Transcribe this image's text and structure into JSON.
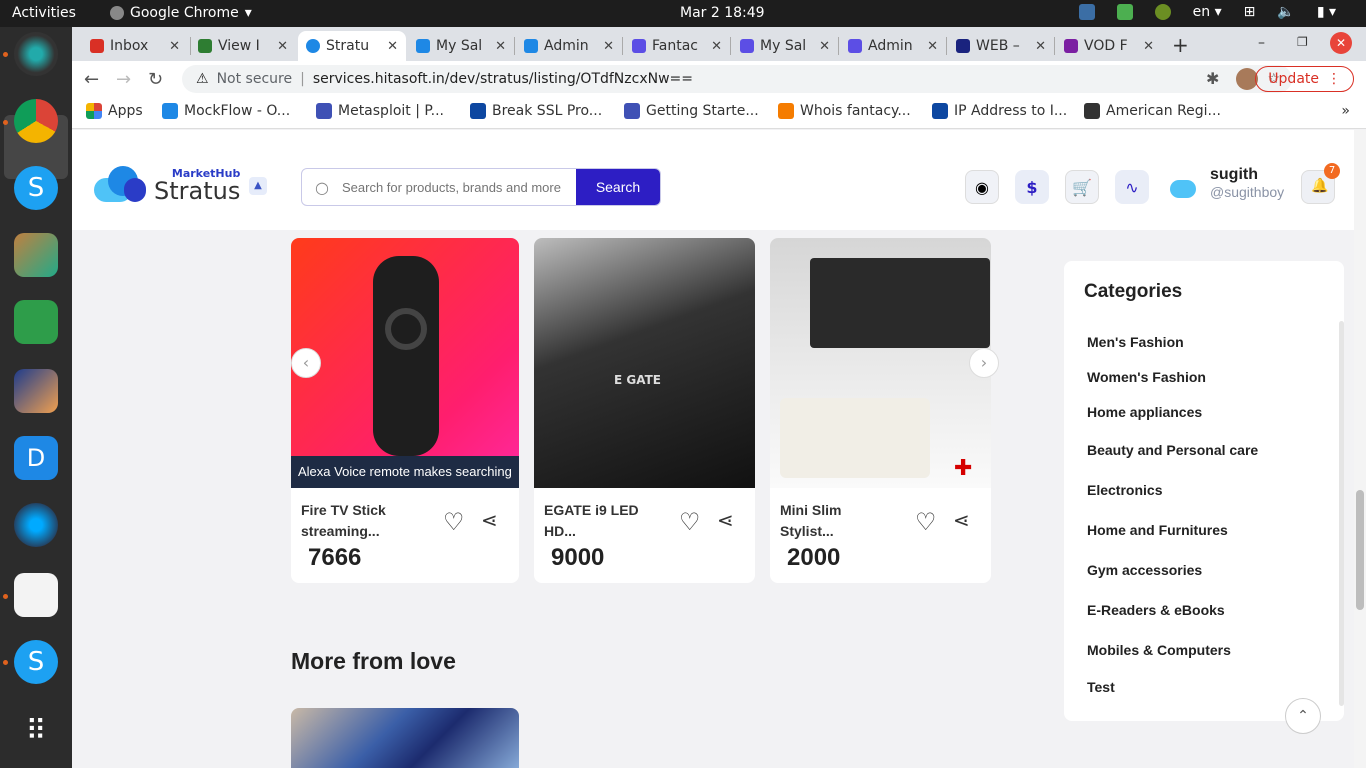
{
  "system": {
    "activities": "Activities",
    "app_name": "Google Chrome",
    "clock": "Mar 2  18:49",
    "lang": "en"
  },
  "tabs": [
    {
      "label": "Inbox",
      "color": "#d93025"
    },
    {
      "label": "View I",
      "color": "#2e7d32"
    },
    {
      "label": "Stratu",
      "color": "#1e88e5"
    },
    {
      "label": "My Sal",
      "color": "#1e88e5"
    },
    {
      "label": "Admin",
      "color": "#1e88e5"
    },
    {
      "label": "Fantac",
      "color": "#5c4ee5"
    },
    {
      "label": "My Sal",
      "color": "#5c4ee5"
    },
    {
      "label": "Admin",
      "color": "#5c4ee5"
    },
    {
      "label": "WEB –",
      "color": "#1a237e"
    },
    {
      "label": "VOD F",
      "color": "#7b1fa2"
    }
  ],
  "address": {
    "security": "Not secure",
    "url": "services.hitasoft.in/dev/stratus/listing/OTdfNzcxNw==",
    "update_label": "Update"
  },
  "bookmarks": [
    {
      "label": "Apps"
    },
    {
      "label": "MockFlow - O..."
    },
    {
      "label": "Metasploit | P..."
    },
    {
      "label": "Break SSL Pro..."
    },
    {
      "label": "Getting Starte..."
    },
    {
      "label": "Whois fantacy..."
    },
    {
      "label": "IP Address to I..."
    },
    {
      "label": "American Regi..."
    }
  ],
  "site": {
    "logo_sub": "MarketHub",
    "logo_main": "Stratus",
    "search_placeholder": "Search for products, brands and more",
    "search_button": "Search",
    "user_name": "sugith",
    "user_handle": "@sugithboy",
    "notification_count": "7",
    "currency_symbol": "$"
  },
  "products": [
    {
      "name_line1": "Fire TV Stick",
      "name_line2": "streaming...",
      "price": "7666",
      "caption": "Alexa Voice remote makes searching"
    },
    {
      "name_line1": "EGATE i9 LED",
      "name_line2": "HD...",
      "price": "9000"
    },
    {
      "name_line1": "Mini Slim",
      "name_line2": "Stylist...",
      "price": "2000"
    }
  ],
  "section": {
    "more_title": "More from love"
  },
  "categories": {
    "title": "Categories",
    "items": [
      "Men's Fashion",
      "Women's Fashion",
      "Home appliances",
      "Beauty and Personal care",
      "Electronics",
      "Home and Furnitures",
      "Gym accessories",
      "E-Readers & eBooks",
      "Mobiles & Computers",
      "Test"
    ]
  }
}
